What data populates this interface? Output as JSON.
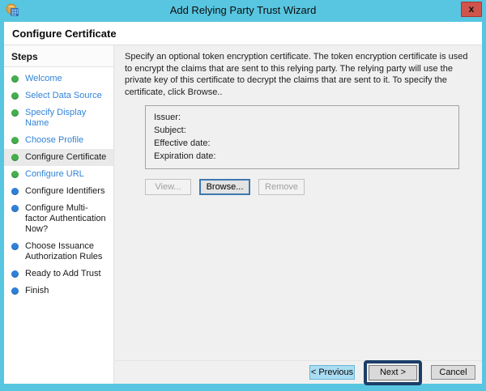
{
  "window": {
    "title": "Add Relying Party Trust Wizard",
    "close_label": "x",
    "icon": "adfs-wizard-icon"
  },
  "header": {
    "title": "Configure Certificate"
  },
  "sidebar": {
    "title": "Steps",
    "items": [
      {
        "label": "Welcome",
        "bullet": "green",
        "link": true,
        "current": false
      },
      {
        "label": "Select Data Source",
        "bullet": "green",
        "link": true,
        "current": false
      },
      {
        "label": "Specify Display Name",
        "bullet": "green",
        "link": true,
        "current": false
      },
      {
        "label": "Choose Profile",
        "bullet": "green",
        "link": true,
        "current": false
      },
      {
        "label": "Configure Certificate",
        "bullet": "green",
        "link": false,
        "current": true
      },
      {
        "label": "Configure URL",
        "bullet": "green",
        "link": true,
        "current": false
      },
      {
        "label": "Configure Identifiers",
        "bullet": "blue",
        "link": false,
        "current": false
      },
      {
        "label": "Configure Multi-factor Authentication Now?",
        "bullet": "blue",
        "link": false,
        "current": false
      },
      {
        "label": "Choose Issuance Authorization Rules",
        "bullet": "blue",
        "link": false,
        "current": false
      },
      {
        "label": "Ready to Add Trust",
        "bullet": "blue",
        "link": false,
        "current": false
      },
      {
        "label": "Finish",
        "bullet": "blue",
        "link": false,
        "current": false
      }
    ]
  },
  "main": {
    "description": "Specify an optional token encryption certificate.  The token encryption certificate is used to encrypt the claims that are sent to this relying party.  The relying party will use the private key of this certificate to decrypt the claims that are sent to it.  To specify the certificate, click Browse..",
    "certificate_fields": {
      "issuer": "Issuer:",
      "subject": "Subject:",
      "effective": "Effective date:",
      "expiration": "Expiration date:"
    },
    "buttons": {
      "view": "View...",
      "browse": "Browse...",
      "remove": "Remove"
    }
  },
  "footer": {
    "previous": "< Previous",
    "next": "Next >",
    "cancel": "Cancel"
  },
  "colors": {
    "accent_teal": "#58C6E1",
    "link_blue": "#3183D6",
    "bullet_green": "#44AF4C",
    "bullet_blue": "#2F80D8",
    "annotation_navy": "#1B3E68",
    "close_red": "#D0544B"
  }
}
